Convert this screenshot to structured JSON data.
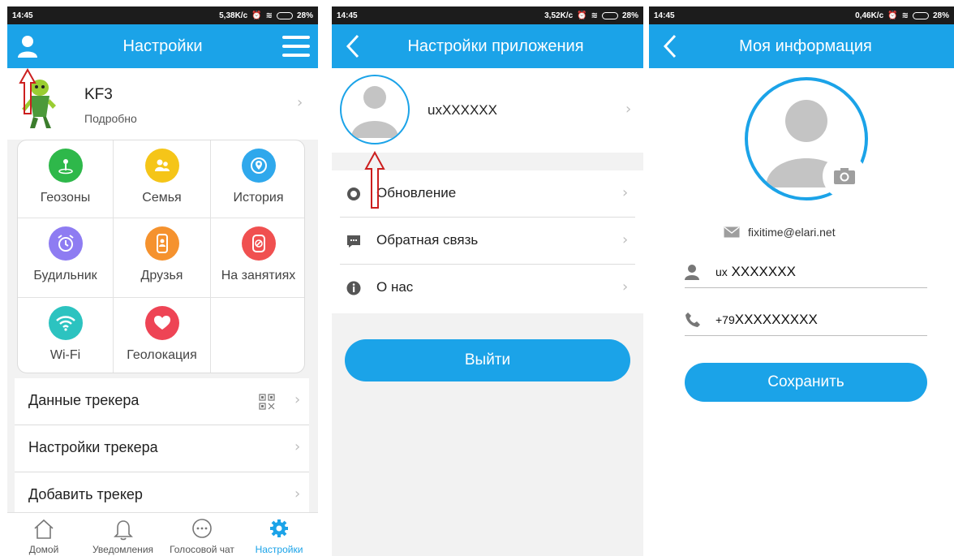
{
  "screens": [
    {
      "status": {
        "time": "14:45",
        "speed": "5,38K/c",
        "battery": "28%"
      },
      "title": "Настройки",
      "profile": {
        "name": "KF3",
        "subtitle": "Подробно"
      },
      "grid": [
        {
          "label": "Геозоны",
          "icon": "geofence-icon",
          "color": "#2eb84a"
        },
        {
          "label": "Семья",
          "icon": "family-icon",
          "color": "#f5c518"
        },
        {
          "label": "История",
          "icon": "history-icon",
          "color": "#2fa8ec"
        },
        {
          "label": "Будильник",
          "icon": "alarm-icon",
          "color": "#8e7cf2"
        },
        {
          "label": "Друзья",
          "icon": "friends-icon",
          "color": "#f5922e"
        },
        {
          "label": "На занятиях",
          "icon": "class-mode-icon",
          "color": "#f05050"
        },
        {
          "label": "Wi-Fi",
          "icon": "wifi-icon",
          "color": "#2cc3c0"
        },
        {
          "label": "Геолокация",
          "icon": "heart-icon",
          "color": "#ee4455"
        }
      ],
      "list": [
        "Данные трекера",
        "Настройки трекера",
        "Добавить трекер"
      ],
      "tabs": [
        "Домой",
        "Уведомления",
        "Голосовой чат",
        "Настройки"
      ],
      "active_tab": "Настройки"
    },
    {
      "status": {
        "time": "14:45",
        "speed": "3,52K/c",
        "battery": "28%"
      },
      "title": "Настройки приложения",
      "username": "uxXXXXXX",
      "list": [
        {
          "label": "Обновление",
          "icon": "update-icon"
        },
        {
          "label": "Обратная связь",
          "icon": "feedback-icon"
        },
        {
          "label": "О нас",
          "icon": "info-icon"
        }
      ],
      "logout_label": "Выйти"
    },
    {
      "status": {
        "time": "14:45",
        "speed": "0,46K/c",
        "battery": "28%"
      },
      "title": "Моя информация",
      "email": "fixitime@elari.net",
      "user_prefix": "ux",
      "user_value": "XXXXXXX",
      "phone_prefix": "+79",
      "phone_value": "XXXXXXXXX",
      "save_label": "Сохранить"
    }
  ],
  "accent_color": "#1ba3e8",
  "annotation_color": "#cc1f1f"
}
